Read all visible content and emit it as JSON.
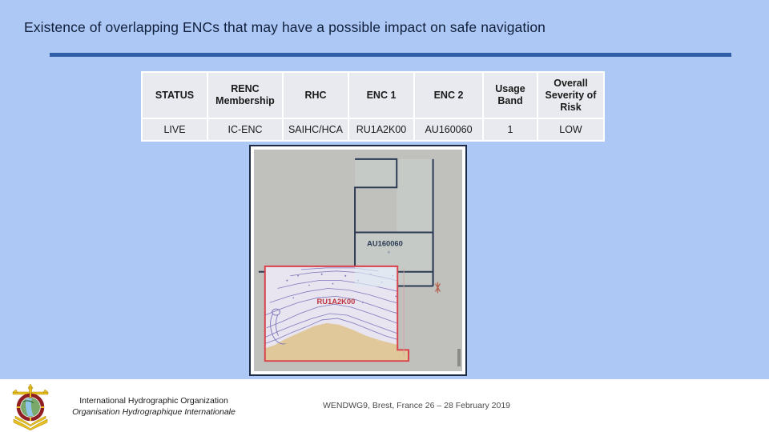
{
  "slide": {
    "title": "Existence of overlapping ENCs that may have a possible impact on safe navigation",
    "background_color": "#adc8f5",
    "rule_color": "#2f5fa8"
  },
  "table": {
    "headers": [
      "STATUS",
      "RENC Membership",
      "RHC",
      "ENC 1",
      "ENC 2",
      "Usage Band",
      "Overall Severity of Risk"
    ],
    "rows": [
      {
        "status": "LIVE",
        "renc_membership": "IC-ENC",
        "rhc": "SAIHC/HCA",
        "enc_1": "RU1A2K00",
        "enc_2": "AU160060",
        "usage_band": "1",
        "overall_severity_of_risk": "LOW"
      }
    ],
    "status_color": "#c00000",
    "cell_background": "#e9eaf0"
  },
  "map": {
    "label_enc_au": "AU160060",
    "label_enc_ru": "RU1A2K00",
    "au_outline_color": "#2b3a52",
    "ru_outline_color": "#d9424a",
    "sea_color": "#c0c0bd",
    "chart_water_color": "#e8e4f0",
    "land_color": "#e0c89a",
    "au_fill_color": "#c8cdc9",
    "marker": "compass-star-marker"
  },
  "footer": {
    "organization_en": "International Hydrographic Organization",
    "organization_fr": "Organisation Hydrographique Internationale",
    "event": "WENDWG9, Brest, France 26 – 28 February 2019",
    "logo_name": "iho-crest-logo"
  }
}
